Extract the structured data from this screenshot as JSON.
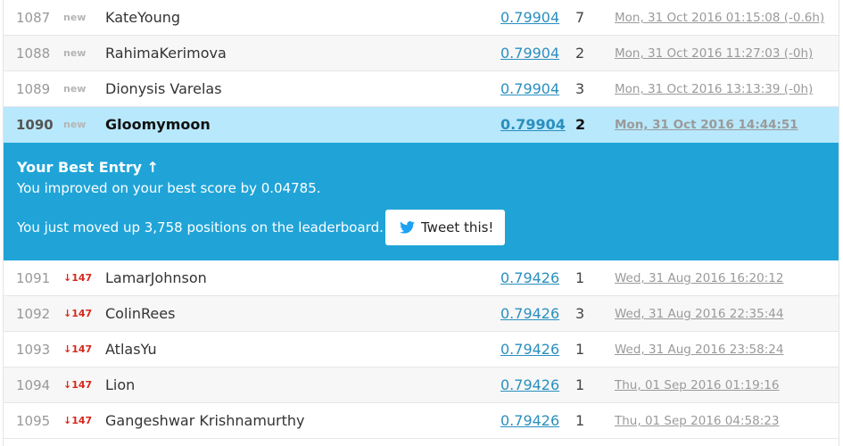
{
  "rows_above": [
    {
      "rank": "1087",
      "change": "new",
      "team": "KateYoung",
      "score": "0.79904",
      "entries": "7",
      "last": "Mon, 31 Oct 2016 01:15:08 (-0.6h)"
    },
    {
      "rank": "1088",
      "change": "new",
      "team": "RahimaKerimova",
      "score": "0.79904",
      "entries": "2",
      "last": "Mon, 31 Oct 2016 11:27:03 (-0h)"
    },
    {
      "rank": "1089",
      "change": "new",
      "team": "Dionysis Varelas",
      "score": "0.79904",
      "entries": "3",
      "last": "Mon, 31 Oct 2016 13:13:39 (-0h)"
    }
  ],
  "my_row": {
    "rank": "1090",
    "change": "new",
    "team": "Gloomymoon",
    "score": "0.79904",
    "entries": "2",
    "last": "Mon, 31 Oct 2016 14:44:51"
  },
  "banner": {
    "title": "Your Best Entry ↑",
    "improved": "You improved on your best score by 0.04785.",
    "moved": "You just moved up 3,758 positions on the leaderboard.",
    "tweet_label": "Tweet this!",
    "tweet_icon": "twitter-bird-icon",
    "background": "#20a4d8"
  },
  "rows_below": [
    {
      "rank": "1091",
      "change": "↓147",
      "team": "LamarJohnson",
      "score": "0.79426",
      "entries": "1",
      "last": "Wed, 31 Aug 2016 16:20:12"
    },
    {
      "rank": "1092",
      "change": "↓147",
      "team": "ColinRees",
      "score": "0.79426",
      "entries": "3",
      "last": "Wed, 31 Aug 2016 22:35:44"
    },
    {
      "rank": "1093",
      "change": "↓147",
      "team": "AtlasYu",
      "score": "0.79426",
      "entries": "1",
      "last": "Wed, 31 Aug 2016 23:58:24"
    },
    {
      "rank": "1094",
      "change": "↓147",
      "team": "Lion",
      "score": "0.79426",
      "entries": "1",
      "last": "Thu, 01 Sep 2016 01:19:16"
    },
    {
      "rank": "1095",
      "change": "↓147",
      "team": "Gangeshwar Krishnamurthy",
      "score": "0.79426",
      "entries": "1",
      "last": "Thu, 01 Sep 2016 04:58:23"
    }
  ],
  "colors": {
    "highlight_row": "#b8e8fb",
    "score_link": "#2a8fbf",
    "rank_drop": "#d9281d"
  }
}
